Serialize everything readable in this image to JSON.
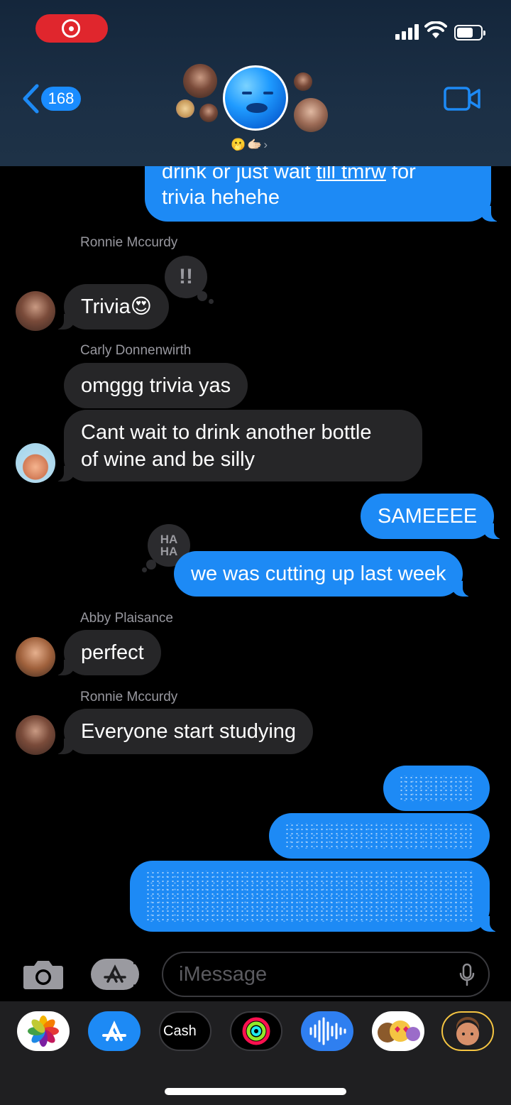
{
  "status_bar": {
    "recording": true,
    "signal": "cellular-signal-icon",
    "wifi": "wifi-icon",
    "battery": "battery-icon"
  },
  "header": {
    "unread_count": "168",
    "back_icon": "chevron-left-icon",
    "video_icon": "video-camera-icon",
    "group_badge": "🫢🫱🏻›"
  },
  "messages": {
    "m0": {
      "text_pre": "drink or just wait ",
      "text_link": "till tmrw",
      "text_post": " for",
      "line2": "trivia hehehe"
    },
    "n1": "Ronnie Mccurdy",
    "m1": "Trivia😍",
    "m1_tapback": "!!",
    "n2": "Carly Donnenwirth",
    "m2": "omggg trivia yas",
    "m3_line1": "Cant wait to drink another bottle",
    "m3_line2": "of wine and be silly",
    "m4": "SAMEEEE",
    "m5_tapback_l1": "HA",
    "m5_tapback_l2": "HA",
    "m5": "we was cutting up last week",
    "n3": "Abby  Plaisance",
    "m6": "perfect",
    "n4": "Ronnie Mccurdy",
    "m7": "Everyone start studying"
  },
  "composer": {
    "placeholder": "iMessage",
    "camera_icon": "camera-icon",
    "apps_icon": "app-store-icon",
    "mic_icon": "microphone-icon"
  },
  "app_drawer": {
    "cash_label": "Cash",
    "apps": [
      "photos-app-icon",
      "app-store-app-icon",
      "apple-cash-app-icon",
      "activity-app-icon",
      "audio-message-app-icon",
      "animoji-app-icon",
      "memoji-app-icon"
    ]
  }
}
